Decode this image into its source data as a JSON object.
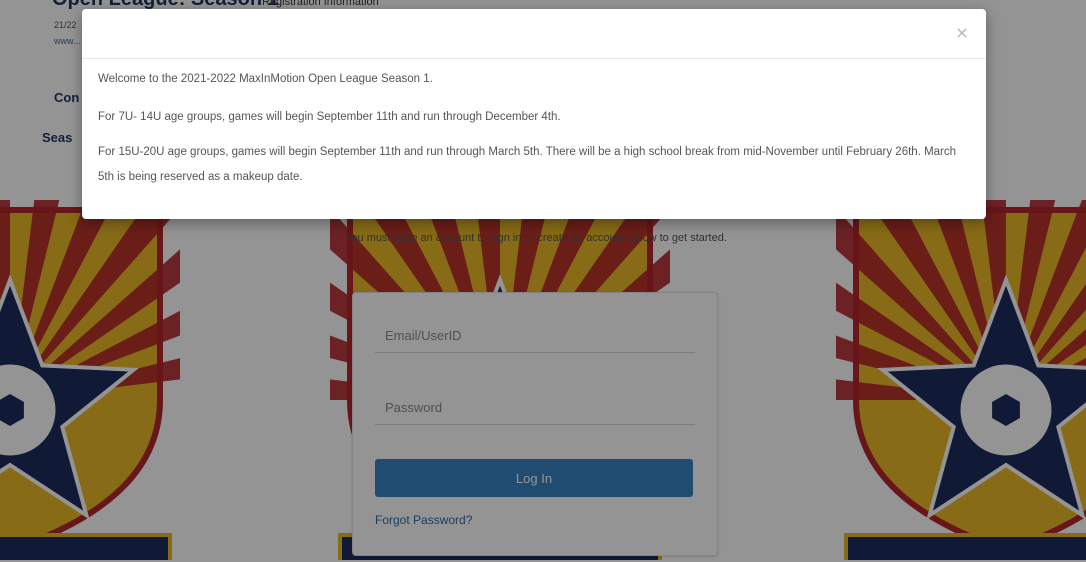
{
  "background_page": {
    "header_title": "Open League: Season 1",
    "registration_badge": "Registration Information",
    "meta_date": "21/22",
    "meta_link": "www...",
    "contact_label": "Con",
    "season_label": "Seas",
    "instructions": "You must have an account to sign in or create an account below to get started.",
    "login": {
      "email_placeholder": "Email/UserID",
      "password_placeholder": "Password",
      "login_button_label": "Log In",
      "forgot_password_label": "Forgot Password?"
    },
    "crest_colors": {
      "red": "#b3262b",
      "gold": "#e9b827",
      "navy": "#1d2d5e",
      "white": "#ffffff"
    }
  },
  "modal": {
    "close_icon": "close-icon",
    "close_label": "×",
    "paragraphs": [
      "Welcome to the 2021-2022 MaxInMotion Open League Season 1.",
      "For 7U- 14U age groups, games will begin September 11th and run through December 4th.",
      "For 15U-20U age groups, games will begin September 11th and run through March 5th.  There will be a high school break from mid-November until February 26th. March 5th is being reserved as a makeup date."
    ]
  },
  "colors": {
    "backdrop": "rgba(0,0,0,0.42)",
    "primary_button": "#3a84c4",
    "link": "#2f6aa8"
  }
}
